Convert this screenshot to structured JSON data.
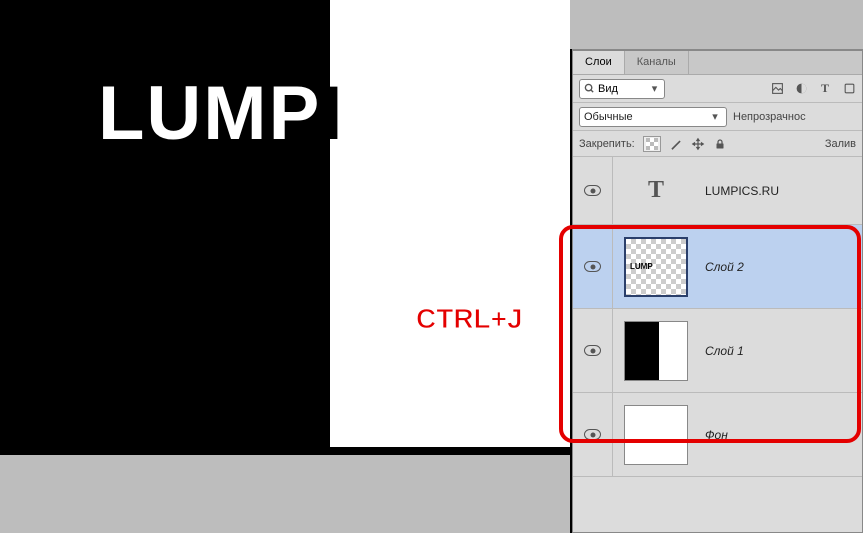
{
  "canvas": {
    "big_text_white": "LUMP",
    "big_text_black_hint": "I",
    "annotation": "CTRL+J"
  },
  "panel": {
    "tabs": {
      "layers": "Слои",
      "channels": "Каналы"
    },
    "search_value": "Вид",
    "blend_mode": "Обычные",
    "opacity_label": "Непрозрачнос",
    "lock_label": "Закрепить:",
    "fill_label": "Залив",
    "icons": {
      "filter": "filter-icon",
      "image": "image-icon",
      "adjust": "adjust-icon",
      "text": "T",
      "shape": "shape-icon",
      "smart": "smart-icon"
    },
    "layers": [
      {
        "type": "text",
        "name": "LUMPICS.RU"
      },
      {
        "type": "raster",
        "name": "Слой 2",
        "selected": true,
        "thumb": "checker-lump"
      },
      {
        "type": "raster",
        "name": "Слой 1",
        "thumb": "bw"
      },
      {
        "type": "raster",
        "name": "Фон",
        "thumb": "white"
      }
    ]
  }
}
